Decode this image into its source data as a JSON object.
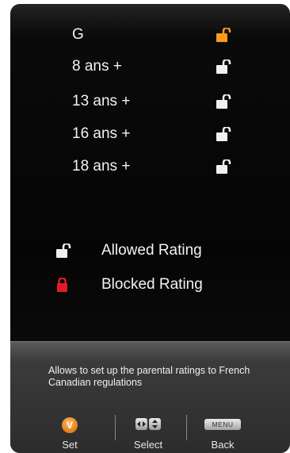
{
  "ratings": [
    {
      "label": "G",
      "state": "selected",
      "lock_color": "#ff9a1a"
    },
    {
      "label": "8 ans +",
      "state": "allowed",
      "lock_color": "#f0f0f0"
    },
    {
      "label": "13 ans +",
      "state": "allowed",
      "lock_color": "#f0f0f0"
    },
    {
      "label": "16 ans +",
      "state": "allowed",
      "lock_color": "#f0f0f0"
    },
    {
      "label": "18 ans +",
      "state": "allowed",
      "lock_color": "#f0f0f0"
    }
  ],
  "legend": {
    "allowed_label": "Allowed Rating",
    "allowed_color": "#f0f0f0",
    "blocked_label": "Blocked Rating",
    "blocked_color": "#e11c24"
  },
  "description": "Allows to set up the parental ratings to French Canadian regulations",
  "controls": {
    "set_key": "V",
    "set_label": "Set",
    "select_label": "Select",
    "menu_key": "MENU",
    "back_label": "Back"
  }
}
